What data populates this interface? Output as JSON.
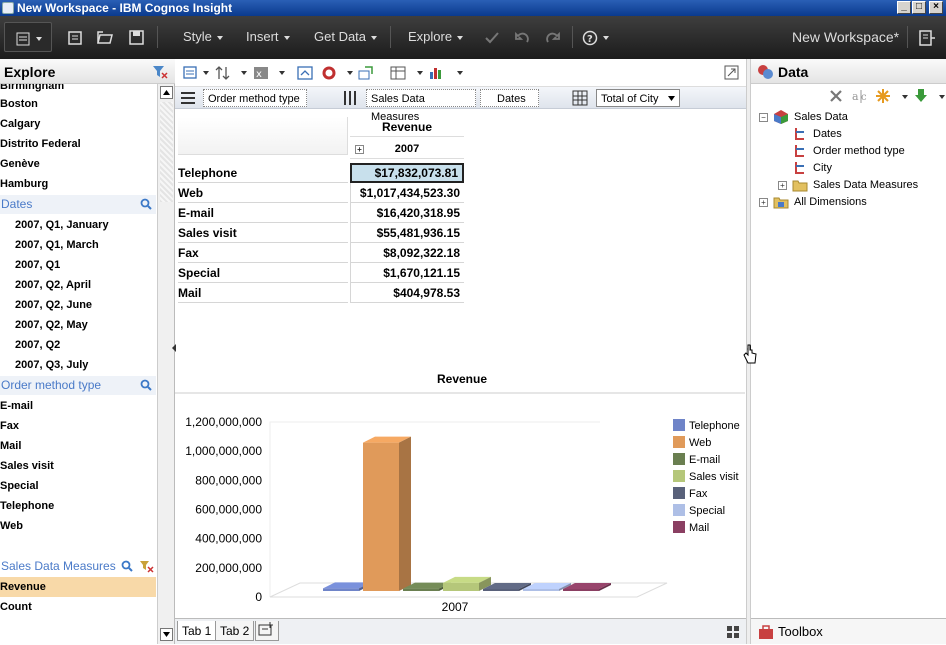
{
  "window": {
    "title": "New Workspace - IBM Cognos Insight"
  },
  "menubar": {
    "items": [
      "Style",
      "Insert",
      "Get Data",
      "Explore"
    ],
    "workspace_name": "New Workspace*"
  },
  "explore": {
    "title": "Explore",
    "cities": [
      "Birmingham",
      "Boston",
      "Calgary",
      "Distrito Federal",
      "Genève",
      "Hamburg"
    ],
    "dates_label": "Dates",
    "dates": [
      "2007, Q1, January",
      "2007, Q1, March",
      "2007, Q1",
      "2007, Q2, April",
      "2007, Q2, June",
      "2007, Q2, May",
      "2007, Q2",
      "2007, Q3, July"
    ],
    "order_label": "Order method type",
    "orders": [
      "E-mail",
      "Fax",
      "Mail",
      "Sales visit",
      "Special",
      "Telephone",
      "Web"
    ],
    "measures_label": "Sales Data Measures",
    "measures": [
      "Revenue",
      "Count"
    ]
  },
  "drop_zones": {
    "rows": "Order method type",
    "columns_1": "Sales Data Measures",
    "columns_2": "Dates",
    "context": "Total of City"
  },
  "crosstab": {
    "measure_header": "Revenue",
    "year_header": "2007",
    "rows": [
      {
        "label": "Telephone",
        "value": "$17,832,073.81"
      },
      {
        "label": "Web",
        "value": "$1,017,434,523.30"
      },
      {
        "label": "E-mail",
        "value": "$16,420,318.95"
      },
      {
        "label": "Sales visit",
        "value": "$55,481,936.15"
      },
      {
        "label": "Fax",
        "value": "$8,092,322.18"
      },
      {
        "label": "Special",
        "value": "$1,670,121.15"
      },
      {
        "label": "Mail",
        "value": "$404,978.53"
      }
    ]
  },
  "chart_data": {
    "type": "bar",
    "title": "Revenue",
    "categories": [
      "2007"
    ],
    "series": [
      {
        "name": "Telephone",
        "values": [
          17832073.81
        ],
        "color": "#6f84c8"
      },
      {
        "name": "Web",
        "values": [
          1017434523.3
        ],
        "color": "#e09a5a"
      },
      {
        "name": "E-mail",
        "values": [
          16420318.95
        ],
        "color": "#6a7f50"
      },
      {
        "name": "Sales visit",
        "values": [
          55481936.15
        ],
        "color": "#b5c77a"
      },
      {
        "name": "Fax",
        "values": [
          8092322.18
        ],
        "color": "#59617a"
      },
      {
        "name": "Special",
        "values": [
          1670121.15
        ],
        "color": "#aebfe6"
      },
      {
        "name": "Mail",
        "values": [
          404978.53
        ],
        "color": "#8a3f62"
      }
    ],
    "ylim": [
      0,
      1200000000
    ],
    "yticks": [
      "1,200,000,000",
      "1,000,000,000",
      "800,000,000",
      "600,000,000",
      "400,000,000",
      "200,000,000",
      "0"
    ],
    "legend": "right"
  },
  "tabs": [
    "Tab 1",
    "Tab 2"
  ],
  "data_panel": {
    "title": "Data",
    "tree": {
      "root": "Sales Data",
      "children": [
        "Dates",
        "Order method type",
        "City",
        "Sales Data Measures"
      ],
      "all": "All Dimensions"
    },
    "toolbox": "Toolbox"
  }
}
